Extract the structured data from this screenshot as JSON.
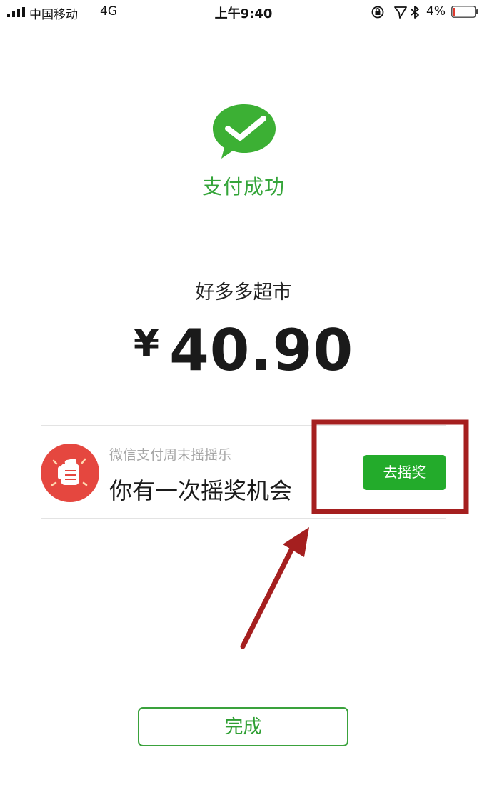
{
  "status_bar": {
    "carrier": "中国移动",
    "network": "4G",
    "time": "上午9:40",
    "battery_percent": "4%"
  },
  "payment": {
    "status_title": "支付成功",
    "merchant": "好多多超市",
    "currency_symbol": "¥",
    "amount": "40.90"
  },
  "promo": {
    "subtitle": "微信支付周末摇摇乐",
    "title": "你有一次摇奖机会",
    "button_label": "去摇奖"
  },
  "footer": {
    "done_label": "完成"
  },
  "colors": {
    "wechat_green": "#35a53a",
    "button_green": "#23ab2b",
    "promo_red": "#e5473f",
    "annotation_red": "#a51f1f"
  }
}
